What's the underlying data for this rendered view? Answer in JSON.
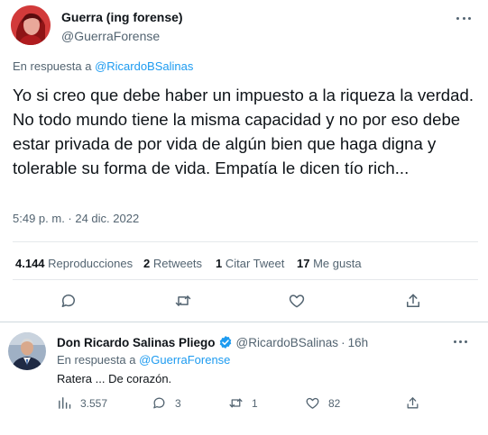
{
  "main_tweet": {
    "author_name": "Guerra (ing forense)",
    "author_handle": "@GuerraForense",
    "reply_prefix": "En respuesta a ",
    "reply_mention": "@RicardoBSalinas",
    "text": "Yo si creo que debe haber un impuesto a la riqueza la verdad. No todo mundo tiene la misma capacidad y no por eso debe estar privada de por vida de algún bien que haga digna y tolerable su forma de vida. Empatía le dicen tío rich...",
    "timestamp": "5:49 p. m. · 24 dic. 2022",
    "stats": {
      "views_count": "4.144",
      "views_label": " Reproducciones",
      "retweets_count": "2",
      "retweets_label": " Retweets",
      "quotes_count": "1",
      "quotes_label": " Citar Tweet",
      "likes_count": "17",
      "likes_label": " Me gusta"
    },
    "actions": [
      "reply",
      "retweet",
      "like",
      "share"
    ]
  },
  "reply_tweet": {
    "author_name": "Don Ricardo Salinas Pliego",
    "author_handle": "@RicardoBSalinas",
    "separator": "·",
    "time": "16h",
    "reply_prefix": "En respuesta a ",
    "reply_mention": "@GuerraForense",
    "text": "Ratera ... De corazón.",
    "counts": {
      "views": "3.557",
      "replies": "3",
      "retweets": "1",
      "likes": "82"
    }
  },
  "colors": {
    "accent": "#1d9bf0",
    "text_primary": "#0f1419",
    "text_secondary": "#536471",
    "divider": "#e5e8eb",
    "verified_badge": "#1d9bf0"
  },
  "icons": [
    "more-icon",
    "reply-icon",
    "retweet-icon",
    "like-icon",
    "share-icon",
    "views-icon",
    "verified-icon"
  ]
}
